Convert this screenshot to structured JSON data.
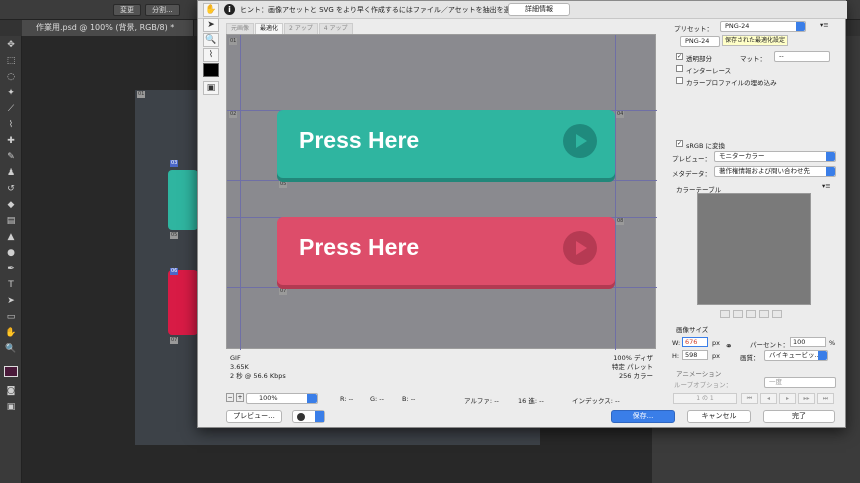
{
  "photoshop": {
    "document_tab": "作業用.psd @ 100% (背景, RGB/8) *",
    "topbar_buttons": [
      "変更",
      "分割..."
    ],
    "slice_tags": [
      "01",
      "03",
      "05",
      "06",
      "07"
    ]
  },
  "dialog": {
    "hint": "ヒント：画像アセットと SVG をより早く作成するにはファイル／アセットを抽出を選択",
    "detail_button": "詳細情報",
    "tabs": [
      "元画像",
      "最適化",
      "2 アップ",
      "4 アップ"
    ],
    "preview": {
      "buttons": [
        {
          "label": "Press Here",
          "color": "#2fb5a0"
        },
        {
          "label": "Press Here",
          "color": "#dd4d6a"
        }
      ],
      "slice_labels": [
        "01",
        "02",
        "03",
        "04",
        "05",
        "06",
        "07",
        "08"
      ]
    },
    "info_left": [
      "GIF",
      "3.65K",
      "2 秒 @ 56.6 Kbps"
    ],
    "info_right": [
      "100% ディザ",
      "特定 パレット",
      "256 カラー"
    ],
    "status": {
      "zoom": "100%",
      "r": "R: --",
      "g": "G: --",
      "b": "B: --",
      "alpha": "アルファ: --",
      "hex": "16 進: --",
      "index": "インデックス: --"
    },
    "preview_button": "プレビュー...",
    "right_panel": {
      "preset_label": "プリセット：",
      "preset_value": "PNG-24",
      "format_value": "PNG-24",
      "tooltip": "保存された最適化設定",
      "transparency": "透明部分",
      "matte_label": "マット：",
      "matte_value": "--",
      "interlace": "インターレース",
      "embed_profile": "カラープロファイルの埋め込み",
      "srgb": "sRGB に変換",
      "preview_label": "プレビュー：",
      "preview_value": "モニターカラー",
      "metadata_label": "メタデータ：",
      "metadata_value": "著作権情報および問い合わせ先",
      "color_table": "カラーテーブル",
      "image_size": "画像サイズ",
      "w_label": "W:",
      "w_value": "676",
      "h_label": "H:",
      "h_value": "598",
      "px": "px",
      "percent_label": "パーセント：",
      "percent_value": "100",
      "percent_sign": "%",
      "quality_label": "画質：",
      "quality_value": "バイキュービッ...",
      "animation": "アニメーション",
      "loop_label": "ループオプション：",
      "loop_value": "一度",
      "frame": "1 の 1"
    },
    "save_button": "保存...",
    "cancel_button": "キャンセル",
    "done_button": "完了"
  }
}
